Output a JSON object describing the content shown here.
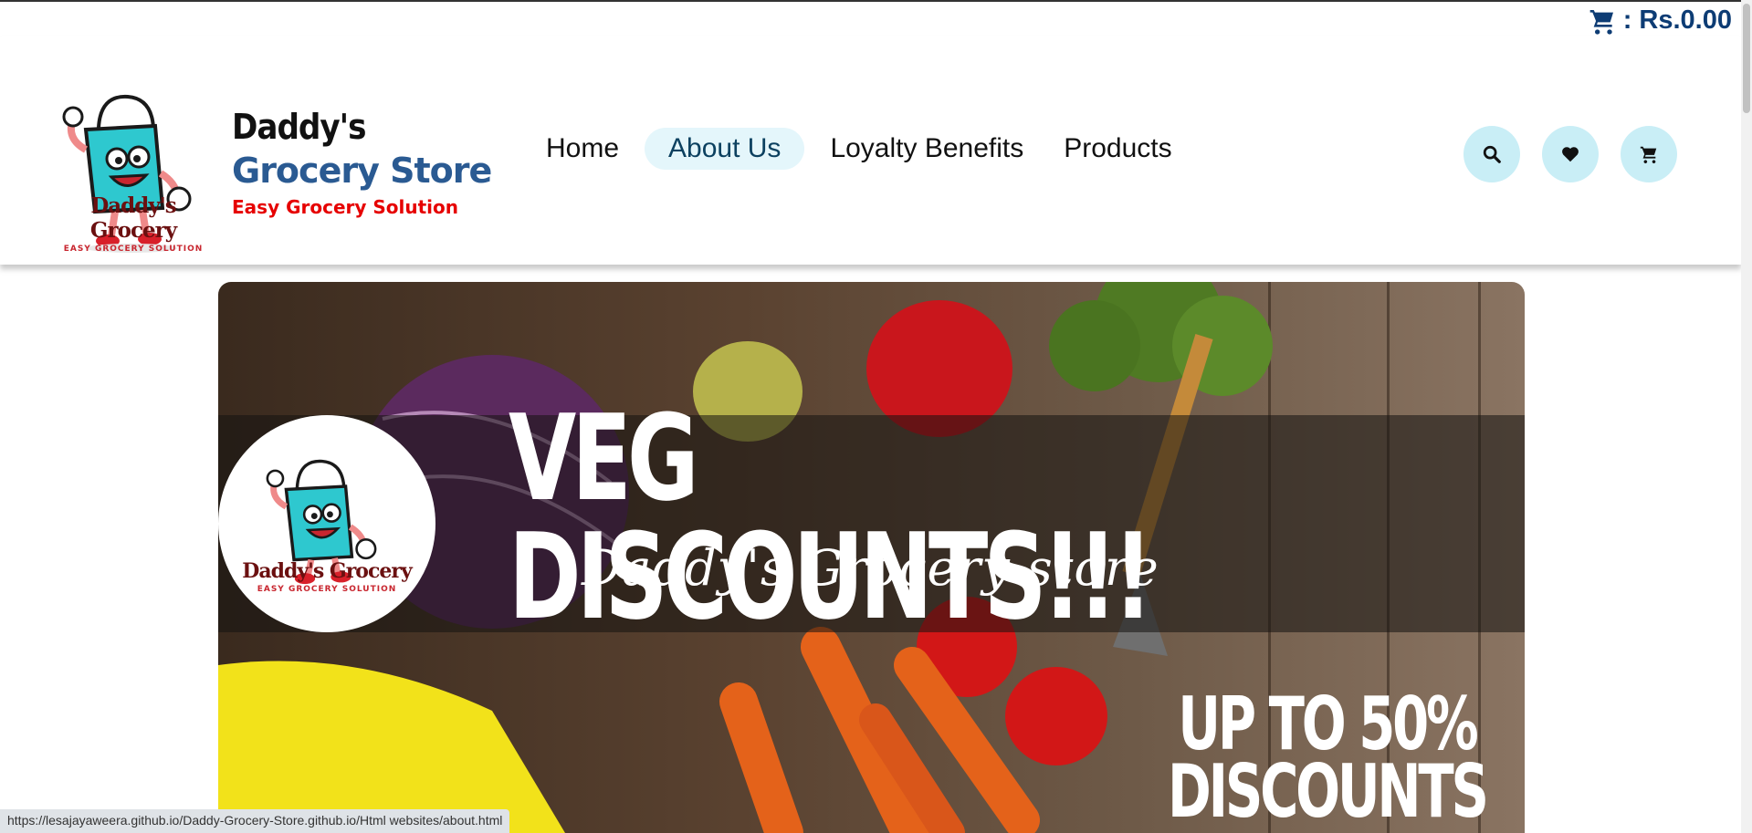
{
  "cart": {
    "label": ": Rs.0.00"
  },
  "brand": {
    "line1": "Daddy's",
    "line2": "Grocery Store",
    "tagline": "Easy Grocery Solution",
    "logo_text": "Daddy's Grocery",
    "logo_sub": "EASY GROCERY SOLUTION"
  },
  "nav": {
    "home": "Home",
    "about": "About Us",
    "loyalty": "Loyalty Benefits",
    "products": "Products"
  },
  "icons": [
    "search-icon",
    "heart-icon",
    "cart-icon"
  ],
  "banner": {
    "title": "VEG DISCOUNTS!!!",
    "subtitle": "Daddy's Grocery store",
    "promo_line1": "UP TO 50%",
    "promo_line2": "DISCOUNTS"
  },
  "status_bar": {
    "url": "https://lesajayaweera.github.io/Daddy-Grocery-Store.github.io/Html websites/about.html"
  },
  "colors": {
    "accent": "#2a5a92",
    "tagline": "#e60000",
    "icon_bg": "#c9eef6",
    "nav_active_bg": "#e4f6fb",
    "cart_text": "#0d3c74"
  }
}
